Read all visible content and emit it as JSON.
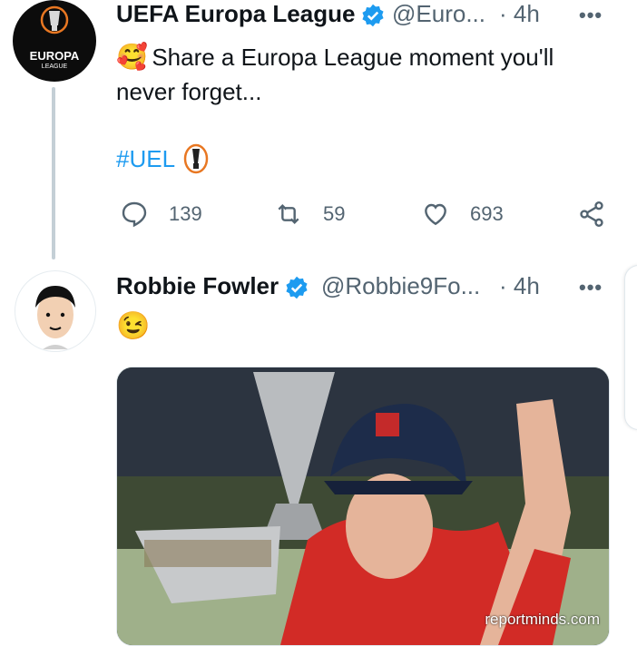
{
  "tweet1": {
    "avatar_label": "EUROPA",
    "avatar_sublabel": "LEAGUE",
    "name": "UEFA Europa League",
    "handle": "@Euro...",
    "time": "· 4h",
    "more": "•••",
    "text": "Share a Europa League moment you'll never forget...",
    "hashtag": "#UEL",
    "replies": "139",
    "retweets": "59",
    "likes": "693"
  },
  "tweet2": {
    "name": "Robbie Fowler",
    "handle": "@Robbie9Fo...",
    "time": "· 4h",
    "more": "•••",
    "emoji": "😉",
    "watermark": "reportminds.com"
  },
  "colors": {
    "link": "#1d9bf0",
    "secondary_text": "#536471",
    "thread_line": "#c4cfd6"
  },
  "icons": [
    "reply-icon",
    "retweet-icon",
    "like-icon",
    "share-icon",
    "verified-icon",
    "more-icon",
    "trophy-icon"
  ]
}
